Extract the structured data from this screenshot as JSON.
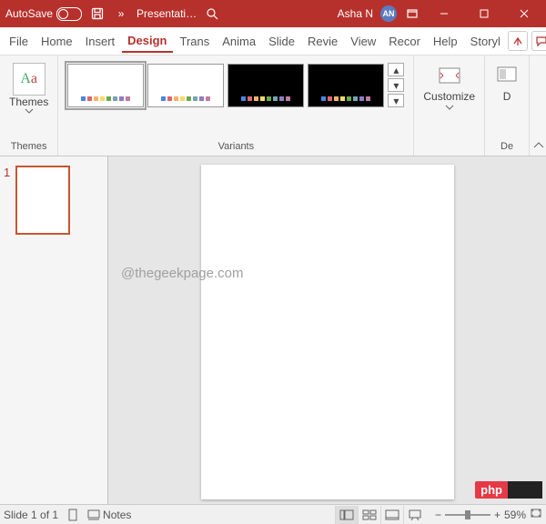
{
  "titlebar": {
    "autosave": "AutoSave",
    "filename": "Presentati…",
    "user": "Asha N",
    "initials": "AN"
  },
  "tabs": [
    "File",
    "Home",
    "Insert",
    "Design",
    "Trans",
    "Anima",
    "Slide",
    "Revie",
    "View",
    "Recor",
    "Help",
    "Storyl"
  ],
  "active_tab": 3,
  "ribbon": {
    "themes_label": "Themes",
    "variants_label": "Variants",
    "customize_label": "Customize",
    "designer_label": "De",
    "d_label": "D"
  },
  "thumbnail": {
    "number": "1"
  },
  "watermark": "@thegeekpage.com",
  "php_label": "php",
  "statusbar": {
    "slide": "Slide 1 of 1",
    "notes": "Notes",
    "zoom": "59%"
  },
  "variant_palette": [
    "#4a86e8",
    "#e06666",
    "#f6b26b",
    "#ffd966",
    "#6aa84f",
    "#76a5af",
    "#8e7cc3",
    "#c27ba0"
  ]
}
